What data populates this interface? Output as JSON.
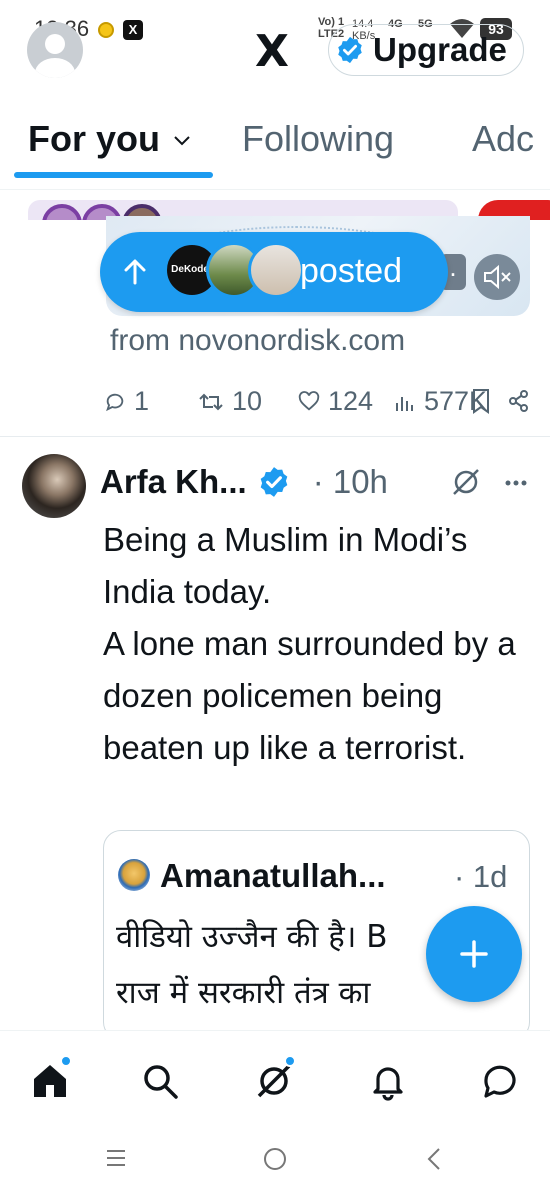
{
  "status_bar": {
    "time": "12:36",
    "notif_x": "X",
    "network": "Vo) 1 LTE2",
    "speed": "14.4 KB/s",
    "gen4": "4G",
    "gen5": "5G",
    "battery": "93"
  },
  "header": {
    "logo": "X",
    "upgrade_label": "Upgrade"
  },
  "tabs": [
    {
      "label": "For you",
      "selected": true
    },
    {
      "label": "Following",
      "selected": false
    },
    {
      "label": "Adc",
      "selected": false
    }
  ],
  "new_posts_pill": {
    "label": "posted",
    "avatar1_text": "DeKoder"
  },
  "ad": {
    "chip": ".",
    "from": "from novonordisk.com",
    "stats": {
      "replies": "1",
      "reposts": "10",
      "likes": "124",
      "views": "577K"
    }
  },
  "tweet": {
    "name": "Arfa Kh...",
    "time": "· 10h",
    "body": "Being a Muslim in Modi’s India today.\nA lone man surrounded by a dozen policemen being beaten up like a terrorist."
  },
  "quote": {
    "name": "Amanatullah...",
    "time": "· 1d",
    "body": "वीडियो उज्जैन की है। B\nराज में सरकारी तंत्र का"
  },
  "colors": {
    "accent": "#1d9bf0",
    "text": "#0f1419",
    "muted": "#536471"
  },
  "icons": [
    "home-icon",
    "search-icon",
    "grok-icon",
    "bell-icon",
    "messages-icon",
    "compose-icon"
  ]
}
